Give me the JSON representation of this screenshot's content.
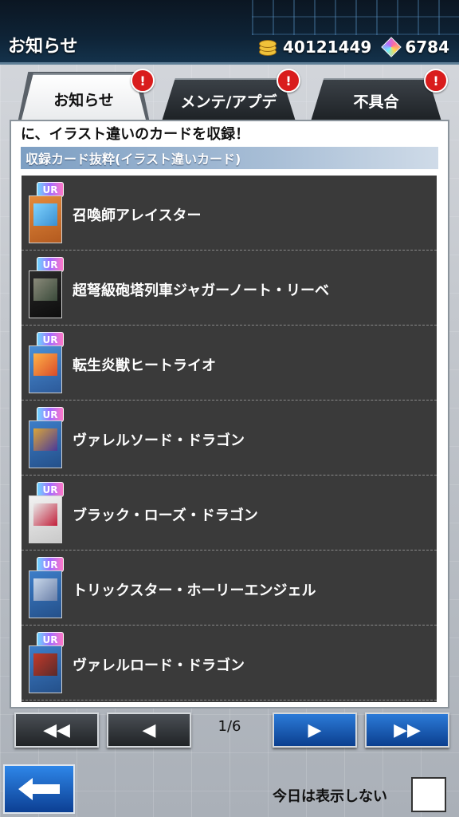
{
  "header": {
    "title": "お知らせ",
    "coins": "40121449",
    "gems": "6784",
    "coin_icon": "coin-stack-icon",
    "gem_icon": "gem-icon"
  },
  "tabs": [
    {
      "label": "お知らせ",
      "active": true,
      "alert": "!"
    },
    {
      "label": "メンテ/アプデ",
      "active": false,
      "alert": "!"
    },
    {
      "label": "不具合",
      "active": false,
      "alert": "!"
    }
  ],
  "notice": {
    "lead_text": "に、イラスト違いのカードを収録！",
    "section_title": "収録カード抜粋(イラスト違いカード)"
  },
  "cards": [
    {
      "rarity": "UR",
      "name": "召喚師アレイスター"
    },
    {
      "rarity": "UR",
      "name": "超弩級砲塔列車ジャガーノート・リーベ"
    },
    {
      "rarity": "UR",
      "name": "転生炎獣ヒートライオ"
    },
    {
      "rarity": "UR",
      "name": "ヴァレルソード・ドラゴン"
    },
    {
      "rarity": "UR",
      "name": "ブラック・ローズ・ドラゴン"
    },
    {
      "rarity": "UR",
      "name": "トリックスター・ホーリーエンジェル"
    },
    {
      "rarity": "UR",
      "name": "ヴァレルロード・ドラゴン"
    }
  ],
  "pagination": {
    "current": "1/6",
    "first_glyph": "◀◀",
    "prev_glyph": "◀",
    "next_glyph": "▶",
    "last_glyph": "▶▶"
  },
  "footer": {
    "hide_today_label": "今日は表示しない"
  },
  "colors": {
    "header_bg": "#0e2336",
    "alert_red": "#d91c1c",
    "list_bg": "#3a3a3a",
    "section_band": "#7d9fc3",
    "pager_blue": "#2c7bd8"
  }
}
